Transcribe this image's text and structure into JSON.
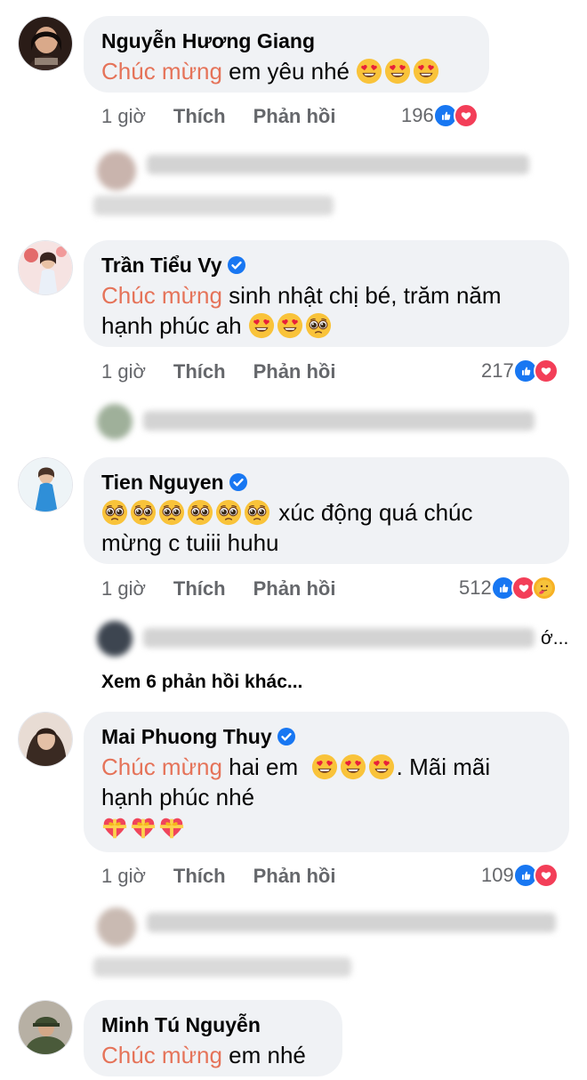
{
  "comments": [
    {
      "name": "Nguyễn Hương Giang",
      "verified": false,
      "highlight": "Chúc mừng",
      "text": "em yêu nhé",
      "time": "1 giờ",
      "like_label": "Thích",
      "reply_label": "Phản hồi",
      "reaction_count": "196",
      "reactions": [
        "like",
        "love"
      ]
    },
    {
      "name": "Trần Tiểu Vy",
      "verified": true,
      "highlight": "Chúc mừng",
      "text_line1": "sinh nhật chị bé, trăm năm",
      "text_line2": "hạnh phúc ah",
      "time": "1 giờ",
      "like_label": "Thích",
      "reply_label": "Phản hồi",
      "reaction_count": "217",
      "reactions": [
        "like",
        "love"
      ]
    },
    {
      "name": "Tien Nguyen",
      "verified": true,
      "text_line1": "xúc động quá chúc",
      "text_line2": "mừng c tuiii huhu",
      "time": "1 giờ",
      "like_label": "Thích",
      "reply_label": "Phản hồi",
      "reaction_count": "512",
      "reactions": [
        "like",
        "love",
        "care"
      ],
      "reply_truncated": "ớ...",
      "see_more": "Xem 6 phản hồi khác..."
    },
    {
      "name": "Mai Phuong Thuy",
      "verified": true,
      "highlight": "Chúc mừng",
      "text_line1_a": "hai em",
      "text_line1_b": ". Mãi mãi",
      "text_line2": "hạnh phúc nhé",
      "time": "1 giờ",
      "like_label": "Thích",
      "reply_label": "Phản hồi",
      "reaction_count": "109",
      "reactions": [
        "like",
        "love"
      ]
    },
    {
      "name": "Minh Tú Nguyễn",
      "verified": false,
      "highlight": "Chúc mừng",
      "text": "em nhé"
    }
  ],
  "colors": {
    "bubble": "#f0f2f5",
    "highlight": "#e57359",
    "meta": "#65676b",
    "like": "#1877f2",
    "love": "#f33e58"
  },
  "icons": [
    "heart-eyes-emoji",
    "pleading-face-emoji",
    "heart-with-ribbon-emoji",
    "verified-badge-icon",
    "like-reaction-icon",
    "love-reaction-icon",
    "care-reaction-icon"
  ]
}
